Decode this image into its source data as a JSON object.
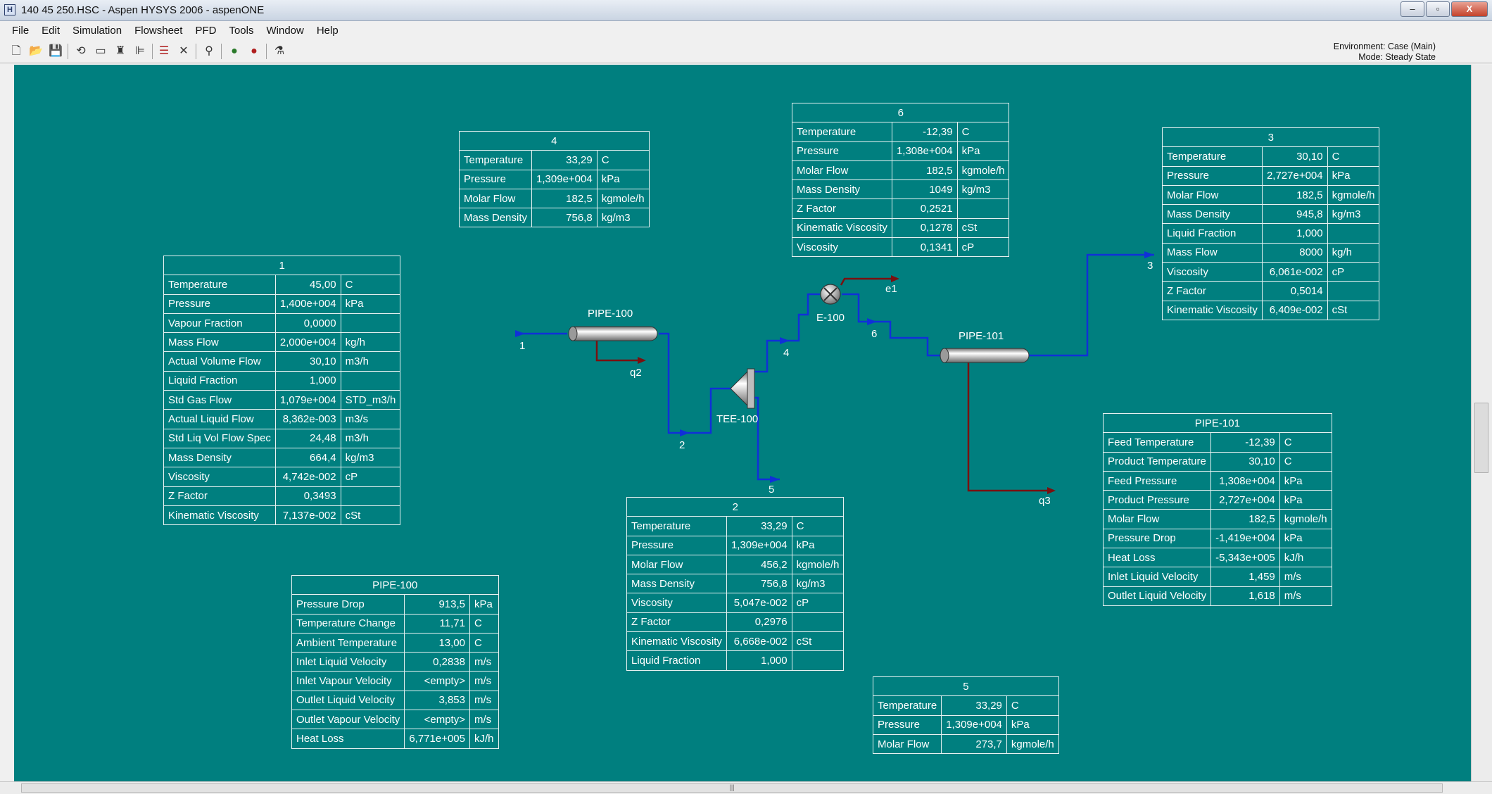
{
  "window": {
    "title": "140 45 250.HSC - Aspen HYSYS 2006 - aspenONE",
    "app_icon": "hysys-app-icon",
    "minimize_label": "–",
    "maximize_label": "▫",
    "close_label": "X"
  },
  "menu": [
    "File",
    "Edit",
    "Simulation",
    "Flowsheet",
    "PFD",
    "Tools",
    "Window",
    "Help"
  ],
  "toolbar": {
    "environment": "Environment: Case (Main)",
    "mode": "Mode: Steady State"
  },
  "colors": {
    "canvas": "#007f7f",
    "stream": "#1030d8",
    "energy": "#7a1010"
  },
  "pfd": {
    "units": {
      "pipe100": "PIPE-100",
      "pipe101": "PIPE-101",
      "tee100": "TEE-100",
      "e100": "E-100"
    },
    "streams": {
      "s1": "1",
      "s2": "2",
      "s3": "3",
      "s4": "4",
      "s5": "5",
      "s6": "6",
      "q2": "q2",
      "q3": "q3",
      "e1": "e1"
    }
  },
  "tables": {
    "t1": {
      "title": "1",
      "rows": [
        [
          "Temperature",
          "45,00",
          "C"
        ],
        [
          "Pressure",
          "1,400e+004",
          "kPa"
        ],
        [
          "Vapour Fraction",
          "0,0000",
          ""
        ],
        [
          "Mass Flow",
          "2,000e+004",
          "kg/h"
        ],
        [
          "Actual Volume Flow",
          "30,10",
          "m3/h"
        ],
        [
          "Liquid Fraction",
          "1,000",
          ""
        ],
        [
          "Std Gas Flow",
          "1,079e+004",
          "STD_m3/h"
        ],
        [
          "Actual Liquid Flow",
          "8,362e-003",
          "m3/s"
        ],
        [
          "Std Liq Vol Flow Spec",
          "24,48",
          "m3/h"
        ],
        [
          "Mass Density",
          "664,4",
          "kg/m3"
        ],
        [
          "Viscosity",
          "4,742e-002",
          "cP"
        ],
        [
          "Z Factor",
          "0,3493",
          ""
        ],
        [
          "Kinematic Viscosity",
          "7,137e-002",
          "cSt"
        ]
      ]
    },
    "t4": {
      "title": "4",
      "rows": [
        [
          "Temperature",
          "33,29",
          "C"
        ],
        [
          "Pressure",
          "1,309e+004",
          "kPa"
        ],
        [
          "Molar Flow",
          "182,5",
          "kgmole/h"
        ],
        [
          "Mass Density",
          "756,8",
          "kg/m3"
        ]
      ]
    },
    "t6": {
      "title": "6",
      "rows": [
        [
          "Temperature",
          "-12,39",
          "C"
        ],
        [
          "Pressure",
          "1,308e+004",
          "kPa"
        ],
        [
          "Molar Flow",
          "182,5",
          "kgmole/h"
        ],
        [
          "Mass Density",
          "1049",
          "kg/m3"
        ],
        [
          "Z Factor",
          "0,2521",
          ""
        ],
        [
          "Kinematic Viscosity",
          "0,1278",
          "cSt"
        ],
        [
          "Viscosity",
          "0,1341",
          "cP"
        ]
      ]
    },
    "t3": {
      "title": "3",
      "rows": [
        [
          "Temperature",
          "30,10",
          "C"
        ],
        [
          "Pressure",
          "2,727e+004",
          "kPa"
        ],
        [
          "Molar Flow",
          "182,5",
          "kgmole/h"
        ],
        [
          "Mass Density",
          "945,8",
          "kg/m3"
        ],
        [
          "Liquid Fraction",
          "1,000",
          ""
        ],
        [
          "Mass Flow",
          "8000",
          "kg/h"
        ],
        [
          "Viscosity",
          "6,061e-002",
          "cP"
        ],
        [
          "Z Factor",
          "0,5014",
          ""
        ],
        [
          "Kinematic Viscosity",
          "6,409e-002",
          "cSt"
        ]
      ]
    },
    "tpipe100": {
      "title": "PIPE-100",
      "rows": [
        [
          "Pressure Drop",
          "913,5",
          "kPa"
        ],
        [
          "Temperature Change",
          "11,71",
          "C"
        ],
        [
          "Ambient Temperature",
          "13,00",
          "C"
        ],
        [
          "Inlet Liquid Velocity",
          "0,2838",
          "m/s"
        ],
        [
          "Inlet Vapour Velocity",
          "<empty>",
          "m/s"
        ],
        [
          "Outlet Liquid Velocity",
          "3,853",
          "m/s"
        ],
        [
          "Outlet Vapour Velocity",
          "<empty>",
          "m/s"
        ],
        [
          "Heat Loss",
          "6,771e+005",
          "kJ/h"
        ]
      ]
    },
    "t2": {
      "title": "2",
      "rows": [
        [
          "Temperature",
          "33,29",
          "C"
        ],
        [
          "Pressure",
          "1,309e+004",
          "kPa"
        ],
        [
          "Molar Flow",
          "456,2",
          "kgmole/h"
        ],
        [
          "Mass Density",
          "756,8",
          "kg/m3"
        ],
        [
          "Viscosity",
          "5,047e-002",
          "cP"
        ],
        [
          "Z Factor",
          "0,2976",
          ""
        ],
        [
          "Kinematic Viscosity",
          "6,668e-002",
          "cSt"
        ],
        [
          "Liquid Fraction",
          "1,000",
          ""
        ]
      ]
    },
    "tpipe101": {
      "title": "PIPE-101",
      "rows": [
        [
          "Feed Temperature",
          "-12,39",
          "C"
        ],
        [
          "Product Temperature",
          "30,10",
          "C"
        ],
        [
          "Feed Pressure",
          "1,308e+004",
          "kPa"
        ],
        [
          "Product Pressure",
          "2,727e+004",
          "kPa"
        ],
        [
          "Molar Flow",
          "182,5",
          "kgmole/h"
        ],
        [
          "Pressure Drop",
          "-1,419e+004",
          "kPa"
        ],
        [
          "Heat Loss",
          "-5,343e+005",
          "kJ/h"
        ],
        [
          "Inlet Liquid Velocity",
          "1,459",
          "m/s"
        ],
        [
          "Outlet Liquid Velocity",
          "1,618",
          "m/s"
        ]
      ]
    },
    "t5": {
      "title": "5",
      "rows": [
        [
          "Temperature",
          "33,29",
          "C"
        ],
        [
          "Pressure",
          "1,309e+004",
          "kPa"
        ],
        [
          "Molar Flow",
          "273,7",
          "kgmole/h"
        ]
      ]
    }
  }
}
